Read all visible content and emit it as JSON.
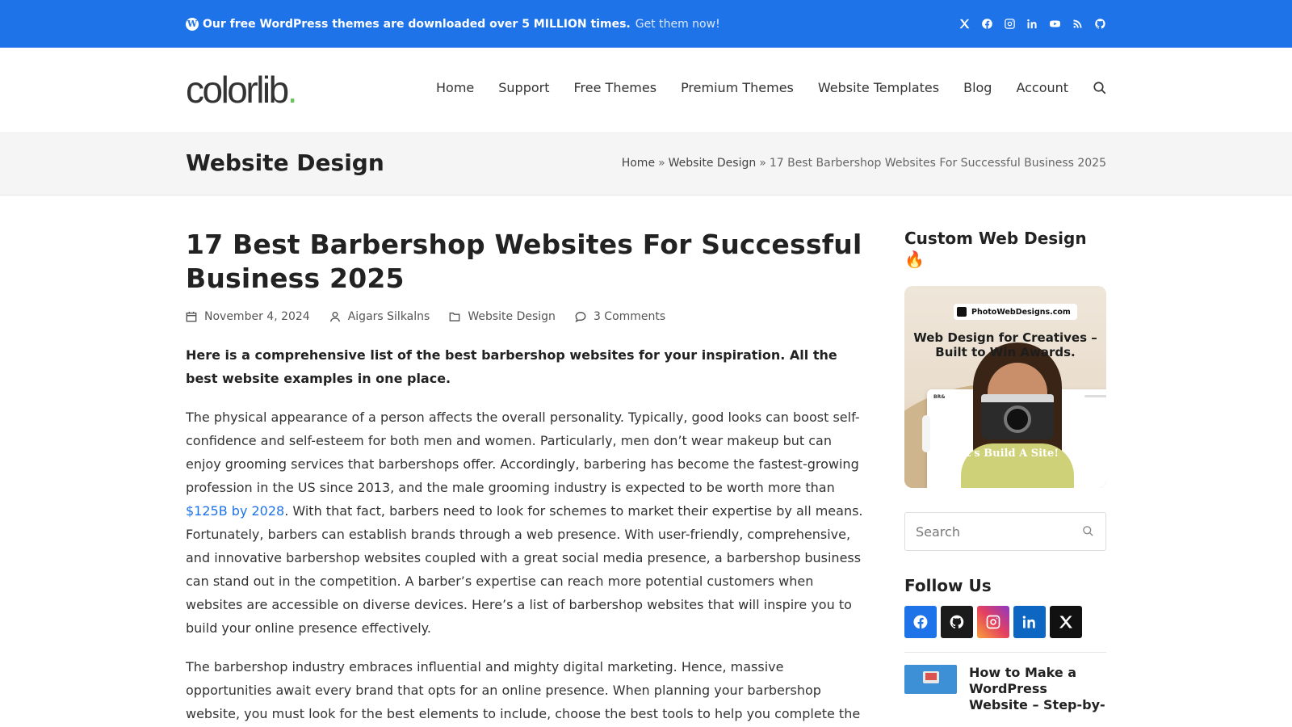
{
  "topbar": {
    "promo_bold": "Our free WordPress themes are downloaded over 5 MILLION times.",
    "promo_link": "Get them now!",
    "socials": [
      "x-icon",
      "facebook-icon",
      "instagram-icon",
      "linkedin-icon",
      "youtube-icon",
      "rss-icon",
      "github-icon"
    ]
  },
  "header": {
    "logo_main": "colorlib",
    "logo_dot": ".",
    "nav": [
      "Home",
      "Support",
      "Free Themes",
      "Premium Themes",
      "Website Templates",
      "Blog",
      "Account"
    ]
  },
  "band": {
    "title": "Website Design",
    "breadcrumb": [
      "Home",
      "Website Design",
      "17 Best Barbershop Websites For Successful Business 2025"
    ],
    "separator": "»"
  },
  "article": {
    "title": "17 Best Barbershop Websites For Successful Business 2025",
    "meta": {
      "date": "November 4, 2024",
      "author": "Aigars Silkalns",
      "category": "Website Design",
      "comments": "3 Comments"
    },
    "lead": "Here is a comprehensive list of the best barbershop websites for your inspiration. All the best website examples in one place.",
    "para1_before": "The physical appearance of a person affects the overall personality. Typically, good looks can boost self-confidence and self-esteem for both men and women. Particularly, men don’t wear makeup but can enjoy grooming services that barbershops offer. Accordingly, barbering has become the fastest-growing profession in the US since 2013, and the male grooming industry is expected to be worth more than ",
    "para1_link": "$125B by 2028",
    "para1_after": ". With that fact, barbers need to look for schemes to market their expertise by all means. Fortunately, barbers can establish brands through a web presence. With user-friendly, comprehensive, and innovative barbershop websites coupled with a great social media presence, a barbershop business can stand out in the competition. A barber’s expertise can reach more potential customers when websites are accessible on diverse devices. Here’s a list of barbershop websites that will inspire you to build your online presence effectively.",
    "para2": "The barbershop industry embraces influential and mighty digital marketing. Hence, massive opportunities await every brand that opts for an online presence. When planning your barbershop website, you must look for the best elements to include, choose the best tools to help you complete the"
  },
  "sidebar": {
    "ad_heading": "Custom Web Design 🔥",
    "ad": {
      "brand": "PhotoWebDesigns.com",
      "headline": "Web Design for Creatives – Built to Win Awards.",
      "cta": "Let's Build A Site!"
    },
    "search_placeholder": "Search",
    "follow_title": "Follow Us",
    "follow_icons": [
      "facebook-icon",
      "github-icon",
      "instagram-icon",
      "linkedin-icon",
      "x-icon"
    ],
    "post_title": "How to Make a WordPress Website – Step-by-"
  },
  "colors": {
    "accent": "#1e73e8",
    "logo_dot": "#6ec15e"
  }
}
